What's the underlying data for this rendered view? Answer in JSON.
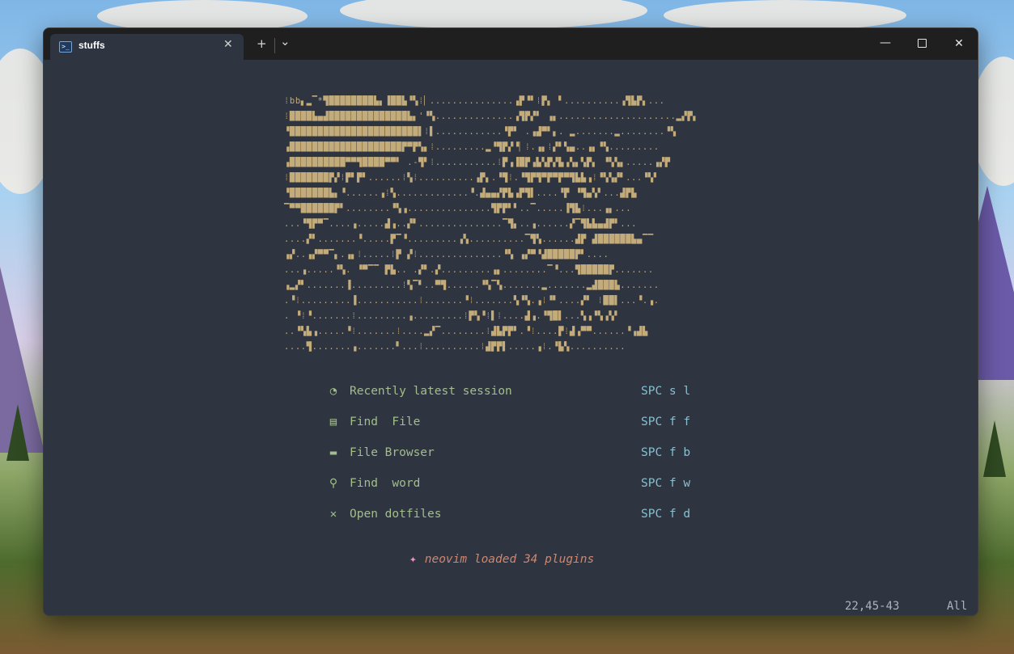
{
  "window": {
    "tab_title": "stuffs",
    "tab_icon": "powershell-icon",
    "new_tab_label": "+",
    "dropdown_label": "⌄",
    "close_tab_label": "✕",
    "minimize_label": "—",
    "close_label": "✕"
  },
  "colors": {
    "terminal_bg": "#2e3440",
    "titlebar_bg": "#1f1f1f",
    "art": "#d0b67f",
    "menu_label": "#a3be8c",
    "menu_key": "#88c0d0",
    "footer": "#d08770"
  },
  "dashboard": {
    "ascii_art": [
      "⁞bb▖▂▔*▜████████▙▖▐██▙▝▚⁞▏...............▗▛▝▘⁞▛▖ ▘..........▗▜▙▛▖...",
      "⁞████▙▄▟██████████████▙▖'▝▚..............▗▜▛▞▘ ▗▖.....................▂▞▛▖",
      "▝███████████████████████▌⁞▌............▝▛▘ .▗▟▀▘▖. ▂.......▂........▝▚",
      "▗████████████████████▛▀▛▚▖⁞.........▂▝▜▛▞▝▏⁞.▗▖⁞▞▘▚▄..▗▖▝▚.........",
      "▗██████████▀▀▜████▀▀▘ .-▜▘⁞...........⁞▛▗▐█▛▗▙▚▛▞▙▗▚▖▚▛▖ ▝▚▚▖.....▗▞▛",
      "⁞███████▛▞⁞▛▘▛▘......⁞▚⁞..........▗▛▖.▝▜⁞.▝▜▛▜▀▛▀▛▀▜▙▙▗⁞▝▚▚▞▘...▝▚▘",
      "▝███████▙▖▝......▗⁞▚.............▝.▟▄▄▞▛▙▗▛▜▌....▝▛ ▝▜▄▚▘...▟▛▙",
      "▔▀▀██████▛▘........▝▚▗...............▜▛▛▘▘..▔.....▐▜▙⁞...▗▖...",
      "...▝▜▛▀▔....▗.....▟▗..▞▘...............▔▜▖..▗......▞▔▜▙▙▄▟▛▘...",
      "....▞▘.......▝.....▛▔▝.........▗▚..........▔▜▚......▟▛ ▟██████▙▄▔▔",
      "▗▞..▗▞▀▀▔▖.▗▖⁞.....⁞▛ ▞⁞...............▝▚ ▗▞▀▝▟█████▛▘....",
      "...▗.....▝▚. ▝▀▔▔ ▛▙.. .▞▘.▞.........▗▖........▔▝...▜█████▛.......",
      "▗▂▞▘.......▐.........⁞▚▔▘..▀▜......▝▚▔▚.......▂.......▂▟███▙.......",
      ".▝⁞.........▐...........⁞.......▝⁞.......▚▝▚.▗⁞▝▘....▞▘ ⁞██▌...▝.▗.",
      ". ▝⁞▝.......⁞.........▗.........⁞▛▚▝⁞▌⁞....▟▗.▝▜█▌...▚▗▝▚▗▚▘",
      "..▝▚▙▗.....▝⁞.......⁞....▂▞▔........⁞▟▙▛▛▘.▝⁞....▛⁞▟▗▀▀......▝▗▟▙",
      "....▜.......▗.......▘...⁞..........⁞▟▛▛▌.....▗⁞.▝▙▚.........."
    ],
    "items": [
      {
        "icon": "history-icon",
        "glyph": "◔",
        "label": "Recently latest session",
        "shortcut": "SPC s l"
      },
      {
        "icon": "file-icon",
        "glyph": "▤",
        "label": "Find  File",
        "shortcut": "SPC f f"
      },
      {
        "icon": "folder-icon",
        "glyph": "▬",
        "label": "File Browser",
        "shortcut": "SPC f b"
      },
      {
        "icon": "search-icon",
        "glyph": "⚲",
        "label": "Find  word",
        "shortcut": "SPC f w"
      },
      {
        "icon": "tools-icon",
        "glyph": "✕",
        "label": "Open dotfiles",
        "shortcut": "SPC f d"
      }
    ],
    "footer_icon": "party-popper-icon",
    "footer_glyph": "✦",
    "footer": "neovim loaded 34 plugins"
  },
  "statusline": {
    "position": "22,45-43",
    "scroll": "All"
  }
}
